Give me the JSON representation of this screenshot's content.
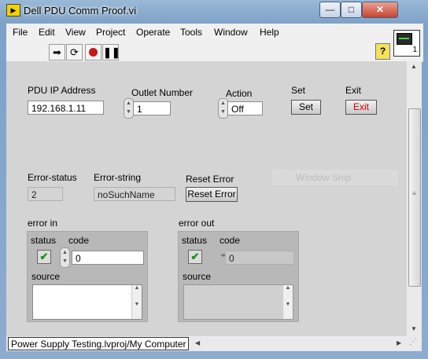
{
  "window": {
    "title": "Dell PDU Comm Proof.vi",
    "min": "—",
    "max": "□",
    "close": "✕"
  },
  "menu": [
    "File",
    "Edit",
    "View",
    "Project",
    "Operate",
    "Tools",
    "Window",
    "Help"
  ],
  "toolbar": {
    "run_icon": "run-arrow-icon",
    "run_cont_icon": "run-continuously-icon",
    "abort_icon": "abort-icon",
    "pause_icon": "pause-icon",
    "help": "?",
    "vi_icon_text": "1"
  },
  "controls": {
    "pdu_ip": {
      "label": "PDU IP Address",
      "value": "192.168.1.11"
    },
    "outlet": {
      "label": "Outlet Number",
      "value": "1"
    },
    "action": {
      "label": "Action",
      "value": "Off"
    },
    "set": {
      "label": "Set",
      "button": "Set"
    },
    "exit": {
      "label": "Exit",
      "button": "Exit"
    },
    "error_status": {
      "label": "Error-status",
      "value": "2"
    },
    "error_string": {
      "label": "Error-string",
      "value": "noSuchName"
    },
    "reset": {
      "label": "Reset Error",
      "button": "Reset Error"
    }
  },
  "error_in": {
    "label": "error in",
    "status_label": "status",
    "code_label": "code",
    "code": "0",
    "source_label": "source",
    "checked": "✔"
  },
  "error_out": {
    "label": "error out",
    "status_label": "status",
    "code_label": "code",
    "code": "0",
    "source_label": "source",
    "checked": "✔"
  },
  "overlay_ghost": "Window Snip",
  "status_bar": {
    "project": "Power Supply Testing.lvproj/My Computer"
  },
  "colors": {
    "exit_text": "#cc0000",
    "check": "#1a8f1a"
  }
}
